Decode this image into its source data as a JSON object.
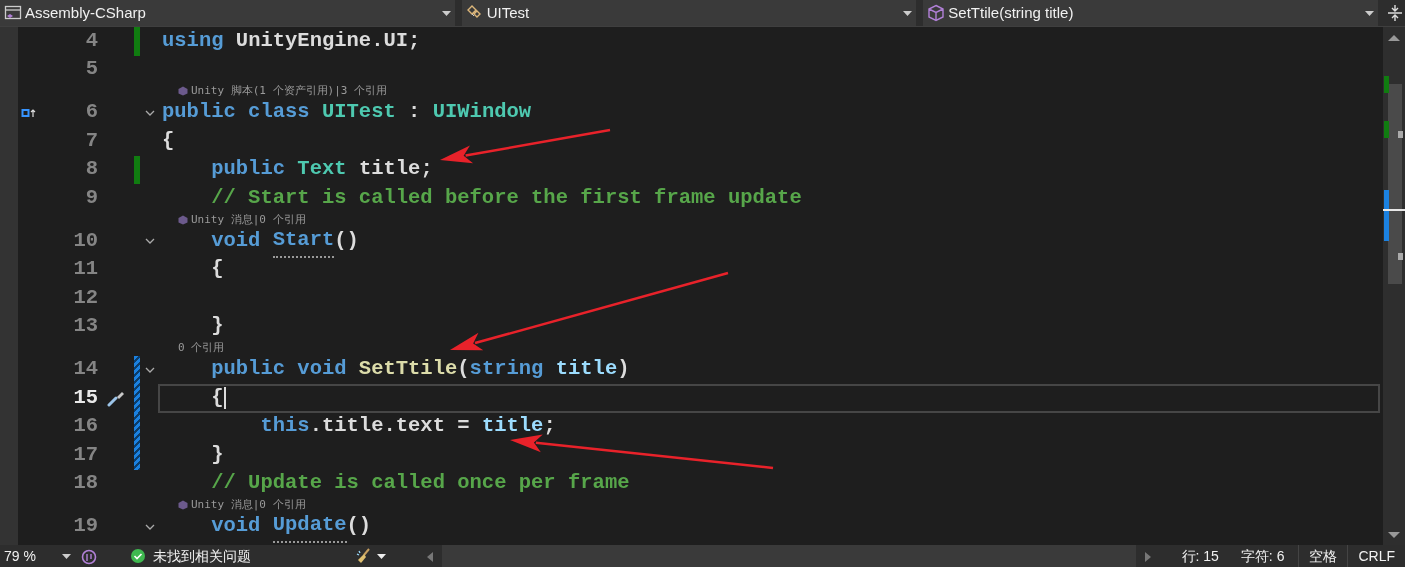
{
  "toolbar": {
    "project": "Assembly-CSharp",
    "type": "UITest",
    "member": "SetTtile(string title)"
  },
  "lines": [
    {
      "number": "4",
      "selected": false,
      "modified": true,
      "saved": true,
      "fold": false,
      "tokens": [
        {
          "text": "using",
          "kind": "keyword"
        },
        {
          "text": " UnityEngine.UI;",
          "kind": "plain"
        }
      ]
    },
    {
      "number": "5",
      "selected": false,
      "modified": false,
      "fold": false
    },
    {
      "number": "6",
      "selected": false,
      "modified": false,
      "fold": true,
      "override_glyph": true,
      "codelens": {
        "text": "Unity 脚本(1 个资产引用)|3 个引用",
        "unity_icon": true
      },
      "tokens": [
        {
          "text": "public class",
          "kind": "keyword"
        },
        {
          "text": " UITest",
          "kind": "type"
        },
        {
          "text": " : ",
          "kind": "plain"
        },
        {
          "text": "UIWindow",
          "kind": "type"
        }
      ]
    },
    {
      "number": "7",
      "selected": false,
      "modified": false,
      "fold": false,
      "tokens": [
        {
          "text": "{",
          "kind": "plain"
        }
      ]
    },
    {
      "number": "8",
      "selected": false,
      "modified": true,
      "saved": true,
      "fold": false,
      "tokens": [
        {
          "text": "    public",
          "kind": "keyword"
        },
        {
          "text": " Text",
          "kind": "type"
        },
        {
          "text": " title;",
          "kind": "plain"
        }
      ]
    },
    {
      "number": "9",
      "selected": false,
      "modified": false,
      "fold": false,
      "tokens": [
        {
          "text": "    // Start is called before the first frame update",
          "kind": "comment"
        }
      ]
    },
    {
      "number": "10",
      "selected": false,
      "modified": false,
      "fold": true,
      "codelens": {
        "text": "Unity 消息|0 个引用",
        "unity_icon": true
      },
      "tokens": [
        {
          "text": "    void",
          "kind": "keyword"
        },
        {
          "text": " Start",
          "kind": "keyword",
          "hint": true
        },
        {
          "text": "()",
          "kind": "plain"
        }
      ]
    },
    {
      "number": "11",
      "selected": false,
      "modified": false,
      "fold": false,
      "tokens": [
        {
          "text": "    {",
          "kind": "plain"
        }
      ]
    },
    {
      "number": "12",
      "selected": false,
      "modified": false,
      "fold": false
    },
    {
      "number": "13",
      "selected": false,
      "modified": false,
      "fold": false,
      "tokens": [
        {
          "text": "    }",
          "kind": "plain"
        }
      ]
    },
    {
      "number": "14",
      "selected": false,
      "modified": true,
      "saved": false,
      "fold": true,
      "codelens": {
        "text": "0 个引用",
        "unity_icon": false
      },
      "tokens": [
        {
          "text": "    public void",
          "kind": "keyword"
        },
        {
          "text": " SetTtile",
          "kind": "method"
        },
        {
          "text": "(",
          "kind": "plain"
        },
        {
          "text": "string",
          "kind": "keyword"
        },
        {
          "text": " title",
          "kind": "param"
        },
        {
          "text": ")",
          "kind": "plain"
        }
      ]
    },
    {
      "number": "15",
      "selected": true,
      "modified": true,
      "saved": false,
      "fold": false,
      "quick_action": true,
      "tokens": [
        {
          "text": "    {",
          "kind": "plain",
          "cursor": true
        }
      ]
    },
    {
      "number": "16",
      "selected": false,
      "modified": true,
      "saved": false,
      "fold": false,
      "tokens": [
        {
          "text": "        this",
          "kind": "keyword"
        },
        {
          "text": ".title.text = ",
          "kind": "plain"
        },
        {
          "text": "title",
          "kind": "param"
        },
        {
          "text": ";",
          "kind": "plain"
        }
      ]
    },
    {
      "number": "17",
      "selected": false,
      "modified": true,
      "saved": false,
      "fold": false,
      "tokens": [
        {
          "text": "    }",
          "kind": "plain"
        }
      ]
    },
    {
      "number": "18",
      "selected": false,
      "modified": false,
      "fold": false,
      "tokens": [
        {
          "text": "    // Update is called once per frame",
          "kind": "comment"
        }
      ]
    },
    {
      "number": "19",
      "selected": false,
      "modified": false,
      "fold": true,
      "codelens": {
        "text": "Unity 消息|0 个引用",
        "unity_icon": true
      },
      "tokens": [
        {
          "text": "    void",
          "kind": "keyword"
        },
        {
          "text": " Update",
          "kind": "keyword",
          "hint": true
        },
        {
          "text": "()",
          "kind": "plain"
        }
      ]
    }
  ],
  "annotations": [
    {
      "kind": "arrow"
    },
    {
      "kind": "arrow"
    },
    {
      "kind": "arrow"
    }
  ],
  "status_bar": {
    "zoom": "79 %",
    "issues": "未找到相关问题",
    "line": "行: 15",
    "column": "字符: 6",
    "whitespace": "空格",
    "line_ending": "CRLF"
  }
}
